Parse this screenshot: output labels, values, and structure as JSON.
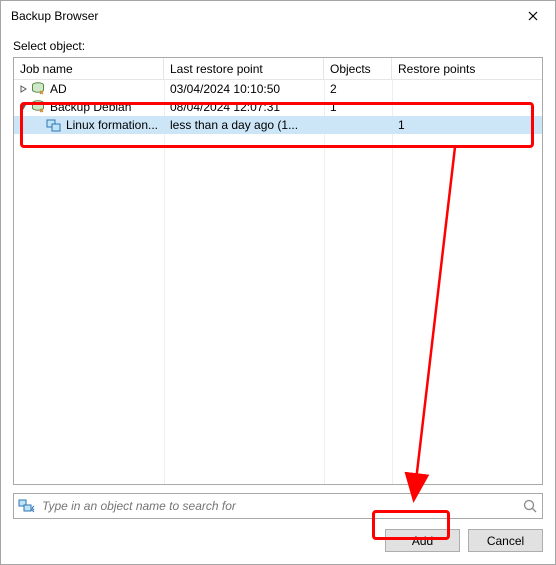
{
  "window": {
    "title": "Backup Browser"
  },
  "label": "Select object:",
  "columns": {
    "job": "Job name",
    "restore": "Last restore point",
    "objects": "Objects",
    "points": "Restore points"
  },
  "rows": [
    {
      "expanded": false,
      "hasChildren": true,
      "level": 0,
      "type": "job",
      "name": "AD",
      "restore": "03/04/2024 10:10:50",
      "objects": "2",
      "points": "",
      "selected": false
    },
    {
      "expanded": true,
      "hasChildren": true,
      "level": 0,
      "type": "job",
      "name": "Backup Debian",
      "restore": "08/04/2024 12:07:31",
      "objects": "1",
      "points": "",
      "selected": false
    },
    {
      "expanded": false,
      "hasChildren": false,
      "level": 1,
      "type": "vm",
      "name": "Linux formation...",
      "restore": "less than a day ago (1...",
      "objects": "",
      "points": "1",
      "selected": true
    }
  ],
  "search": {
    "placeholder": "Type in an object name to search for"
  },
  "buttons": {
    "add": "Add",
    "cancel": "Cancel"
  }
}
